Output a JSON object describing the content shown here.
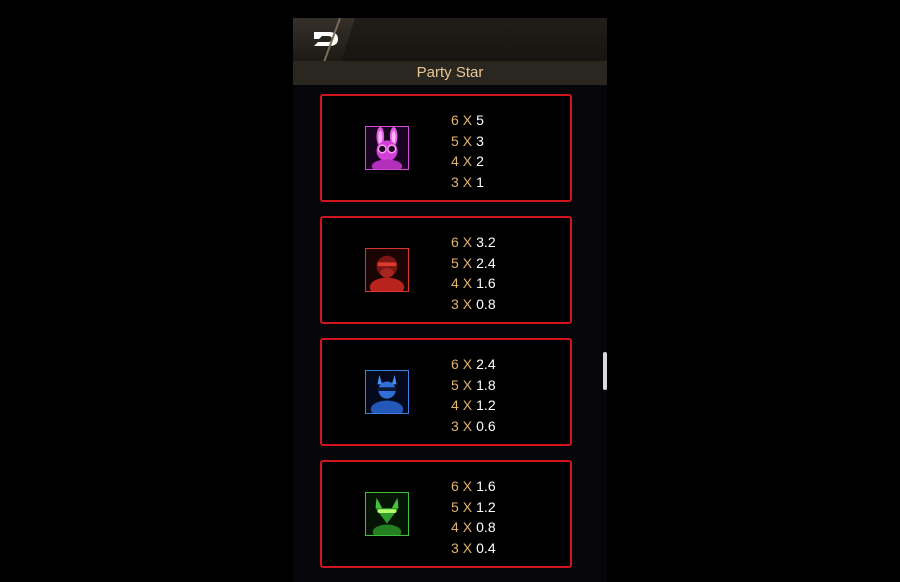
{
  "header": {
    "title": "Party Star",
    "back_icon": "back-arrow-icon"
  },
  "colors": {
    "accent_gold": "#e2b46c",
    "card_border": "#d0161c",
    "title": "#e8c896"
  },
  "paytable": [
    {
      "symbol": "pink-bunny",
      "frame_color": "#d04bd6",
      "rows": [
        {
          "count": "6",
          "x": "X",
          "value": "5"
        },
        {
          "count": "5",
          "x": "X",
          "value": "3"
        },
        {
          "count": "4",
          "x": "X",
          "value": "2"
        },
        {
          "count": "3",
          "x": "X",
          "value": "1"
        }
      ]
    },
    {
      "symbol": "red-gorilla",
      "frame_color": "#d9342a",
      "rows": [
        {
          "count": "6",
          "x": "X",
          "value": "3.2"
        },
        {
          "count": "5",
          "x": "X",
          "value": "2.4"
        },
        {
          "count": "4",
          "x": "X",
          "value": "1.6"
        },
        {
          "count": "3",
          "x": "X",
          "value": "0.8"
        }
      ]
    },
    {
      "symbol": "blue-llama",
      "frame_color": "#3b7fe0",
      "rows": [
        {
          "count": "6",
          "x": "X",
          "value": "2.4"
        },
        {
          "count": "5",
          "x": "X",
          "value": "1.8"
        },
        {
          "count": "4",
          "x": "X",
          "value": "1.2"
        },
        {
          "count": "3",
          "x": "X",
          "value": "0.6"
        }
      ]
    },
    {
      "symbol": "green-fox",
      "frame_color": "#3fbf3a",
      "rows": [
        {
          "count": "6",
          "x": "X",
          "value": "1.6"
        },
        {
          "count": "5",
          "x": "X",
          "value": "1.2"
        },
        {
          "count": "4",
          "x": "X",
          "value": "0.8"
        },
        {
          "count": "3",
          "x": "X",
          "value": "0.4"
        }
      ]
    }
  ]
}
